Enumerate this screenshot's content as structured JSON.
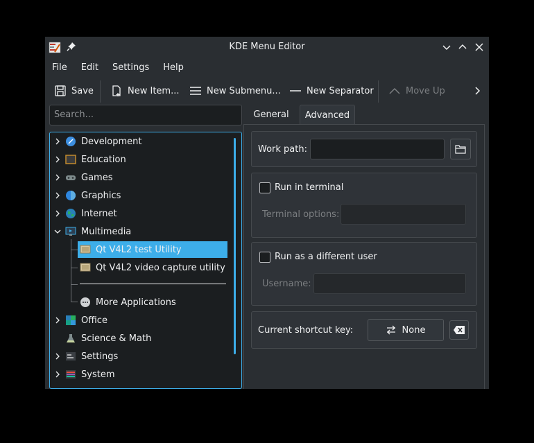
{
  "window": {
    "title": "KDE Menu Editor"
  },
  "menubar": {
    "items": [
      "File",
      "Edit",
      "Settings",
      "Help"
    ]
  },
  "toolbar": {
    "save": "Save",
    "new_item": "New Item...",
    "new_submenu": "New Submenu...",
    "new_separator": "New Separator",
    "move_up": "Move Up"
  },
  "search": {
    "placeholder": "Search..."
  },
  "tree": {
    "items": [
      {
        "label": "Development",
        "icon": "development-icon",
        "expandable": true
      },
      {
        "label": "Education",
        "icon": "education-icon",
        "expandable": true
      },
      {
        "label": "Games",
        "icon": "games-icon",
        "expandable": true
      },
      {
        "label": "Graphics",
        "icon": "graphics-icon",
        "expandable": true
      },
      {
        "label": "Internet",
        "icon": "internet-icon",
        "expandable": true
      },
      {
        "label": "Multimedia",
        "icon": "multimedia-icon",
        "expanded": true
      },
      {
        "label": "Qt V4L2 test Utility",
        "icon": "qv4l2-icon",
        "selected": true
      },
      {
        "label": "Qt V4L2 video capture utility",
        "icon": "qvidcap-icon"
      },
      {
        "label": "More Applications",
        "icon": "more-apps-icon"
      },
      {
        "label": "Office",
        "icon": "office-icon",
        "expandable": true
      },
      {
        "label": "Science & Math",
        "icon": "science-icon"
      },
      {
        "label": "Settings",
        "icon": "settings-icon",
        "expandable": true
      },
      {
        "label": "System",
        "icon": "system-icon",
        "expandable": true
      }
    ]
  },
  "tabs": {
    "general": "General",
    "advanced": "Advanced",
    "active": "Advanced"
  },
  "advanced": {
    "work_path_label": "Work path:",
    "work_path_value": "",
    "run_in_terminal_label": "Run in terminal",
    "run_in_terminal_checked": false,
    "terminal_options_label": "Terminal options:",
    "terminal_options_value": "",
    "run_as_user_label": "Run as a different user",
    "run_as_user_checked": false,
    "username_label": "Username:",
    "username_value": "",
    "shortcut_label": "Current shortcut key:",
    "shortcut_value": "None"
  },
  "colors": {
    "accent": "#3daee9",
    "window_bg": "#2a2e32",
    "view_bg": "#1b1e20"
  }
}
